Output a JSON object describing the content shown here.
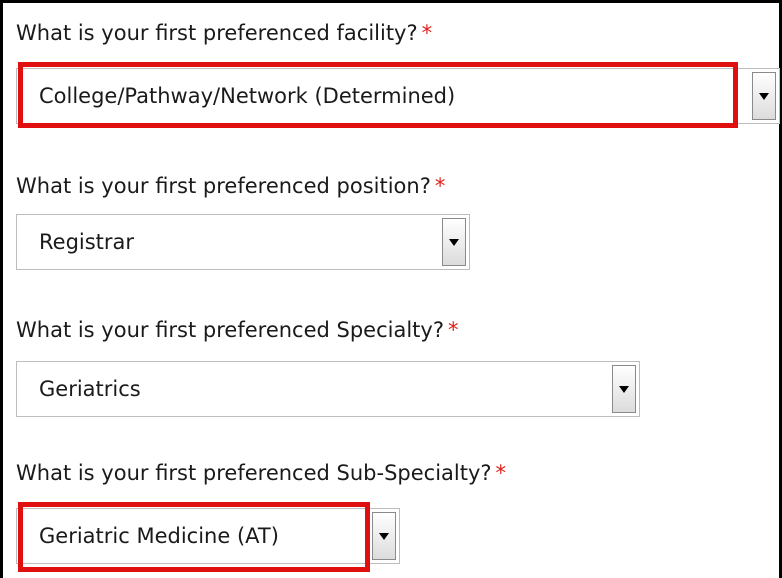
{
  "form": {
    "questions": [
      {
        "label": "What is your first preferenced facility?",
        "required_mark": "*",
        "selected_value": "College/Pathway/Network (Determined)",
        "highlighted": true
      },
      {
        "label": "What is your first preferenced position?",
        "required_mark": "*",
        "selected_value": "Registrar",
        "highlighted": false
      },
      {
        "label": "What is your first preferenced Specialty?",
        "required_mark": "*",
        "selected_value": "Geriatrics",
        "highlighted": false
      },
      {
        "label": "What is your first preferenced Sub-Specialty?",
        "required_mark": "*",
        "selected_value": "Geriatric Medicine (AT)",
        "highlighted": true
      }
    ]
  },
  "colors": {
    "required_asterisk": "#e0201a",
    "highlight_border": "#e01010",
    "frame_border": "#000000"
  },
  "icons": {
    "dropdown_arrow": "chevron-down-icon"
  }
}
